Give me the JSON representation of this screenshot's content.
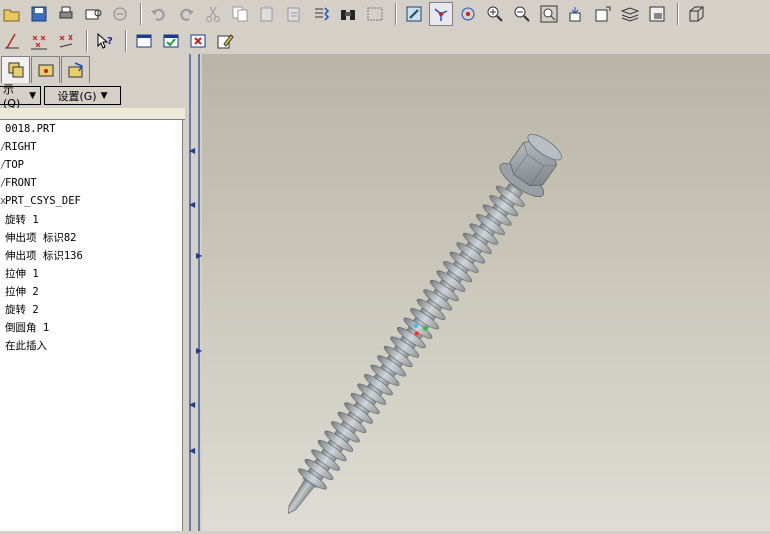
{
  "toolbar": {
    "row1_icons": [
      "open-icon",
      "save-icon",
      "print-icon",
      "send-icon",
      "email-icon",
      "undo-icon",
      "redo-icon",
      "cut-icon",
      "copy-icon",
      "paste-icon",
      "paste-special-icon",
      "regenerate-icon",
      "find-icon",
      "select-box-icon",
      "repaint-icon",
      "spin-center-icon",
      "orient-icon",
      "zoom-in-icon",
      "zoom-out-icon",
      "refit-icon",
      "reorient-icon",
      "saved-views-icon",
      "layers-icon",
      "view-manager-icon",
      "shading-icon"
    ],
    "row2_icons": [
      "datum-axis-icon",
      "datum-point-icon",
      "datum-csys-icon",
      "whats-this-icon",
      "new-window-icon",
      "close-window-icon",
      "cancel-icon",
      "edit-icon"
    ]
  },
  "left_pane": {
    "tabs": [
      "model-tree-tab",
      "folder-browser-tab",
      "favorites-tab"
    ],
    "show_menu": "示(Q)",
    "settings_menu": "设置(G)"
  },
  "model_tree": {
    "items": [
      {
        "prefix": "",
        "label": "0018.PRT"
      },
      {
        "prefix": "/",
        "label": "RIGHT"
      },
      {
        "prefix": "/",
        "label": "TOP"
      },
      {
        "prefix": "/",
        "label": "FRONT"
      },
      {
        "prefix": "x",
        "label": "PRT_CSYS_DEF"
      },
      {
        "prefix": "",
        "label": "旋转 1"
      },
      {
        "prefix": "",
        "label": "伸出项 标识82"
      },
      {
        "prefix": "",
        "label": "伸出项 标识136"
      },
      {
        "prefix": "",
        "label": "拉伸 1"
      },
      {
        "prefix": "",
        "label": "拉伸 2"
      },
      {
        "prefix": "",
        "label": "旋转 2"
      },
      {
        "prefix": "",
        "label": "倒圆角 1"
      },
      {
        "prefix": "",
        "label": "在此插入"
      }
    ]
  },
  "viewport": {
    "model": "self-drilling-hex-screw",
    "colors": {
      "background_top": "#b8b5a6",
      "background_bottom": "#dedcd4",
      "part": "#a7adb2",
      "csys_x": "#ff3030",
      "csys_y": "#20c040",
      "csys_z": "#30c0ff"
    }
  }
}
